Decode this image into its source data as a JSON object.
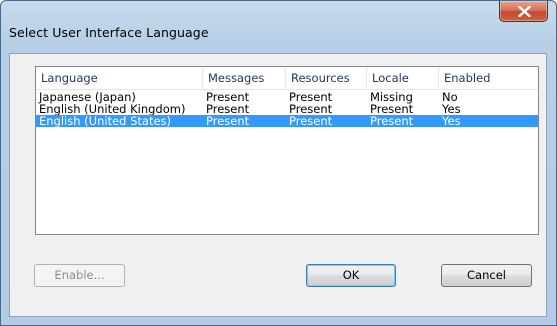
{
  "window": {
    "title": "Select User Interface Language"
  },
  "listview": {
    "columns": [
      "Language",
      "Messages",
      "Resources",
      "Locale",
      "Enabled"
    ],
    "rows": [
      {
        "language": "Japanese (Japan)",
        "messages": "Present",
        "resources": "Present",
        "locale": "Missing",
        "enabled": "No",
        "selected": false
      },
      {
        "language": "English (United Kingdom)",
        "messages": "Present",
        "resources": "Present",
        "locale": "Present",
        "enabled": "Yes",
        "selected": false
      },
      {
        "language": "English (United States)",
        "messages": "Present",
        "resources": "Present",
        "locale": "Present",
        "enabled": "Yes",
        "selected": true
      }
    ]
  },
  "buttons": {
    "enable_label": "Enable...",
    "ok_label": "OK",
    "cancel_label": "Cancel"
  },
  "colors": {
    "selection": "#3399ff",
    "frame": "#b7cfe6",
    "close_button": "#c24a32"
  }
}
